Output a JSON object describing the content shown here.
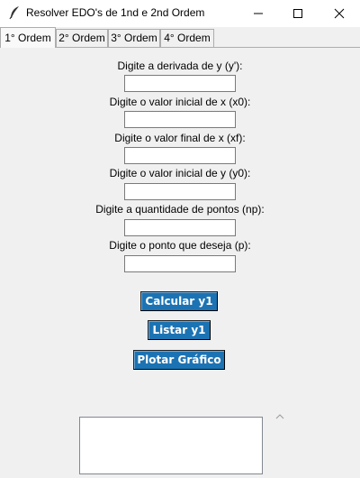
{
  "window": {
    "title": "Resolver EDO's de 1nd e 2nd Ordem"
  },
  "tabs": [
    {
      "label": "1° Ordem",
      "active": true
    },
    {
      "label": "2° Ordem",
      "active": false
    },
    {
      "label": "3° Ordem",
      "active": false
    },
    {
      "label": "4° Ordem",
      "active": false
    }
  ],
  "form": {
    "fields": [
      {
        "label": "Digite a derivada de y (y'):",
        "value": ""
      },
      {
        "label": "Digite o valor inicial de x (x0):",
        "value": ""
      },
      {
        "label": "Digite o valor final de x (xf):",
        "value": ""
      },
      {
        "label": "Digite o valor inicial de y (y0):",
        "value": ""
      },
      {
        "label": "Digite a quantidade de pontos (np):",
        "value": ""
      },
      {
        "label": "Digite o ponto que deseja (p):",
        "value": ""
      }
    ]
  },
  "actions": {
    "calcular": "Calcular y1",
    "listar": "Listar y1",
    "plotar": "Plotar Gráfico"
  },
  "output": {
    "text": ""
  },
  "colors": {
    "button_bg": "#1c73b3",
    "button_text": "#ffffff",
    "panel_bg": "#f0f0f0"
  },
  "icons": {
    "app": "feather-icon",
    "minimize": "minimize-icon",
    "maximize": "maximize-icon",
    "close": "close-icon",
    "scroll": "chevron-up-icon"
  }
}
